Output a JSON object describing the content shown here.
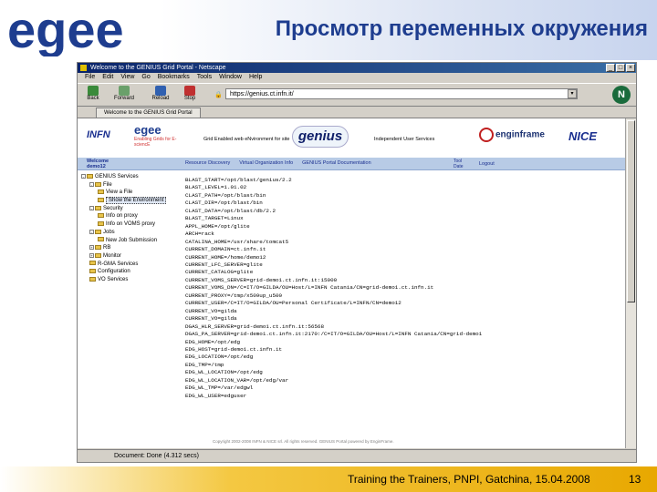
{
  "slide": {
    "title": "Просмотр переменных окружения",
    "logo_text": "egee",
    "footer": "Training the Trainers, PNPI, Gatchina, 15.04.2008",
    "page_number": "13",
    "colors": {
      "title": "#1e3d8f",
      "footer_band": "#e8a800"
    }
  },
  "browser": {
    "window_title": "Welcome to the GENIUS Grid Portal - Netscape",
    "menu": [
      "File",
      "Edit",
      "View",
      "Go",
      "Bookmarks",
      "Tools",
      "Window",
      "Help"
    ],
    "toolbar": [
      {
        "label": "Back",
        "icon": "back-arrow-icon"
      },
      {
        "label": "Forward",
        "icon": "forward-arrow-icon"
      },
      {
        "label": "Reload",
        "icon": "reload-icon"
      },
      {
        "label": "Stop",
        "icon": "stop-icon"
      }
    ],
    "address": "https://genius.ct.infn.it/",
    "tab": "Welcome to the GENIUS Grid Portal",
    "status": "Document: Done (4.312 secs)"
  },
  "portal": {
    "infn": "INFN",
    "egee_name": "egee",
    "egee_sub": "Enabling Grids for E-sciencE",
    "tagline_left": "Grid Enabled web eNvironment for site",
    "genius": "genius",
    "tagline_right": "Independent User Services",
    "engframe": "enginframe",
    "nice": "NICE",
    "welcome": [
      "Welcome",
      "demo12"
    ],
    "nav": [
      "Resource Discovery",
      "Virtual Organization Info",
      "GENIUS Portal Documentation"
    ],
    "nav_right": [
      "Tool",
      "Date"
    ],
    "logout": "Logout"
  },
  "tree": [
    {
      "label": "GENIUS Services",
      "level": 0,
      "exp": "-",
      "selected": false
    },
    {
      "label": "File",
      "level": 1,
      "exp": "-",
      "selected": false
    },
    {
      "label": "View a File",
      "level": 2,
      "exp": "",
      "selected": false
    },
    {
      "label": "Show the Environment",
      "level": 2,
      "exp": "",
      "selected": true
    },
    {
      "label": "Security",
      "level": 1,
      "exp": "-",
      "selected": false
    },
    {
      "label": "Info on proxy",
      "level": 2,
      "exp": "",
      "selected": false
    },
    {
      "label": "Info on VOMS proxy",
      "level": 2,
      "exp": "",
      "selected": false
    },
    {
      "label": "Jobs",
      "level": 1,
      "exp": "-",
      "selected": false
    },
    {
      "label": "New Job Submission",
      "level": 2,
      "exp": "",
      "selected": false
    },
    {
      "label": "RB",
      "level": 1,
      "exp": "+",
      "selected": false
    },
    {
      "label": "Monitor",
      "level": 1,
      "exp": "+",
      "selected": false
    },
    {
      "label": "R-GMA Services",
      "level": 1,
      "exp": "",
      "selected": false
    },
    {
      "label": "Configuration",
      "level": 1,
      "exp": "",
      "selected": false
    },
    {
      "label": "VO Services",
      "level": 1,
      "exp": "",
      "selected": false
    }
  ],
  "env_lines": [
    "BLAST_START=/opt/blast/genius/2.2",
    "BLAST_LEVEL=1.01.02",
    "CLAST_PATH=/opt/blast/bin",
    "CLAST_DIR=/opt/blast/bin",
    "CLAST_DATA=/opt/blast/db/2.2",
    "BLAST_TARGET=Linux",
    "APPL_HOME=/opt/glite",
    "ARCH=rack",
    "CATALINA_HOME=/usr/share/tomcat5",
    "CURRENT_DOMAIN=ct.infn.it",
    "CURRENT_HOME=/home/demo12",
    "CURRENT_LFC_SERVER=glite",
    "CURRENT_CATALOG=glite",
    "CURRENT_VOMS_SERVER=grid-demo1.ct.infn.it:15000",
    "CURRENT_VOMS_DN=/C=IT/O=GILDA/OU=Host/L=INFN Catania/CN=grid-demo1.ct.infn.it",
    "CURRENT_PROXY=/tmp/x509up_u500",
    "CURRENT_USER=/C=IT/O=GILDA/OU=Personal Certificate/L=INFN/CN=demo12",
    "CURRENT_VO=gilda",
    "CURRENT_VO=gilda",
    "DGAS_HLR_SERVER=grid-demo1.ct.infn.it:56568",
    "DGAS_PA_SERVER=grid-demo1.ct.infn.it:2170:/C=IT/O=GILDA/OU=Host/L=INFN Catania/CN=grid-demo1",
    "EDG_HOME=/opt/edg",
    "EDG_HOST=grid-demo1.ct.infn.it",
    "EDG_LOCATION=/opt/edg",
    "EDG_TMP=/tmp",
    "EDG_WL_LOCATION=/opt/edg",
    "EDG_WL_LOCATION_VAR=/opt/edg/var",
    "EDG_WL_TMP=/var/edgwl",
    "EDG_WL_USER=edguser"
  ],
  "footer_note": "Copyright 2002-2008 INFN & NICE srl. All rights reserved. GENIUS Portal powered by EnginFrame."
}
